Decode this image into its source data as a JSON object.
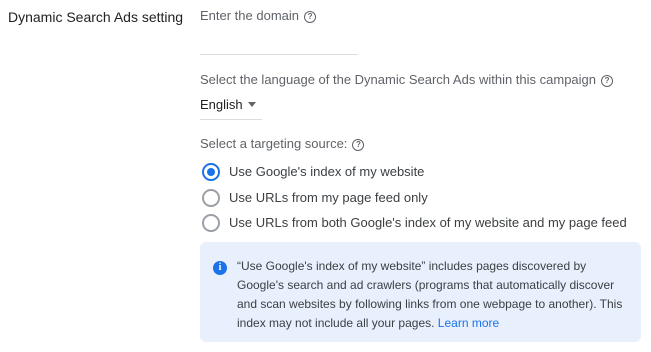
{
  "section": {
    "label": "Dynamic Search Ads setting"
  },
  "domain": {
    "label": "Enter the domain",
    "value": "",
    "placeholder": ""
  },
  "language": {
    "label": "Select the language of the Dynamic Search Ads within this campaign",
    "selected": "English"
  },
  "targeting": {
    "label": "Select a targeting source:",
    "options": [
      {
        "label": "Use Google's index of my website",
        "checked": true
      },
      {
        "label": "Use URLs from my page feed only",
        "checked": false
      },
      {
        "label": "Use URLs from both Google's index of my website and my page feed",
        "checked": false
      }
    ]
  },
  "info": {
    "text": "“Use Google's index of my website” includes pages discovered by Google's search and ad crawlers (programs that automatically discover and scan websites by following links from one webpage to another). This index may not include all your pages.",
    "link": "Learn more"
  },
  "icons": {
    "help": "?",
    "info": "i",
    "help_icon_name": "help-icon",
    "info_icon_name": "info-icon",
    "dropdown_icon_name": "dropdown-arrow-icon"
  },
  "colors": {
    "accent": "#1a73e8",
    "info_background": "#e8f0fe",
    "text": "#5f6368",
    "heading": "#202124"
  }
}
